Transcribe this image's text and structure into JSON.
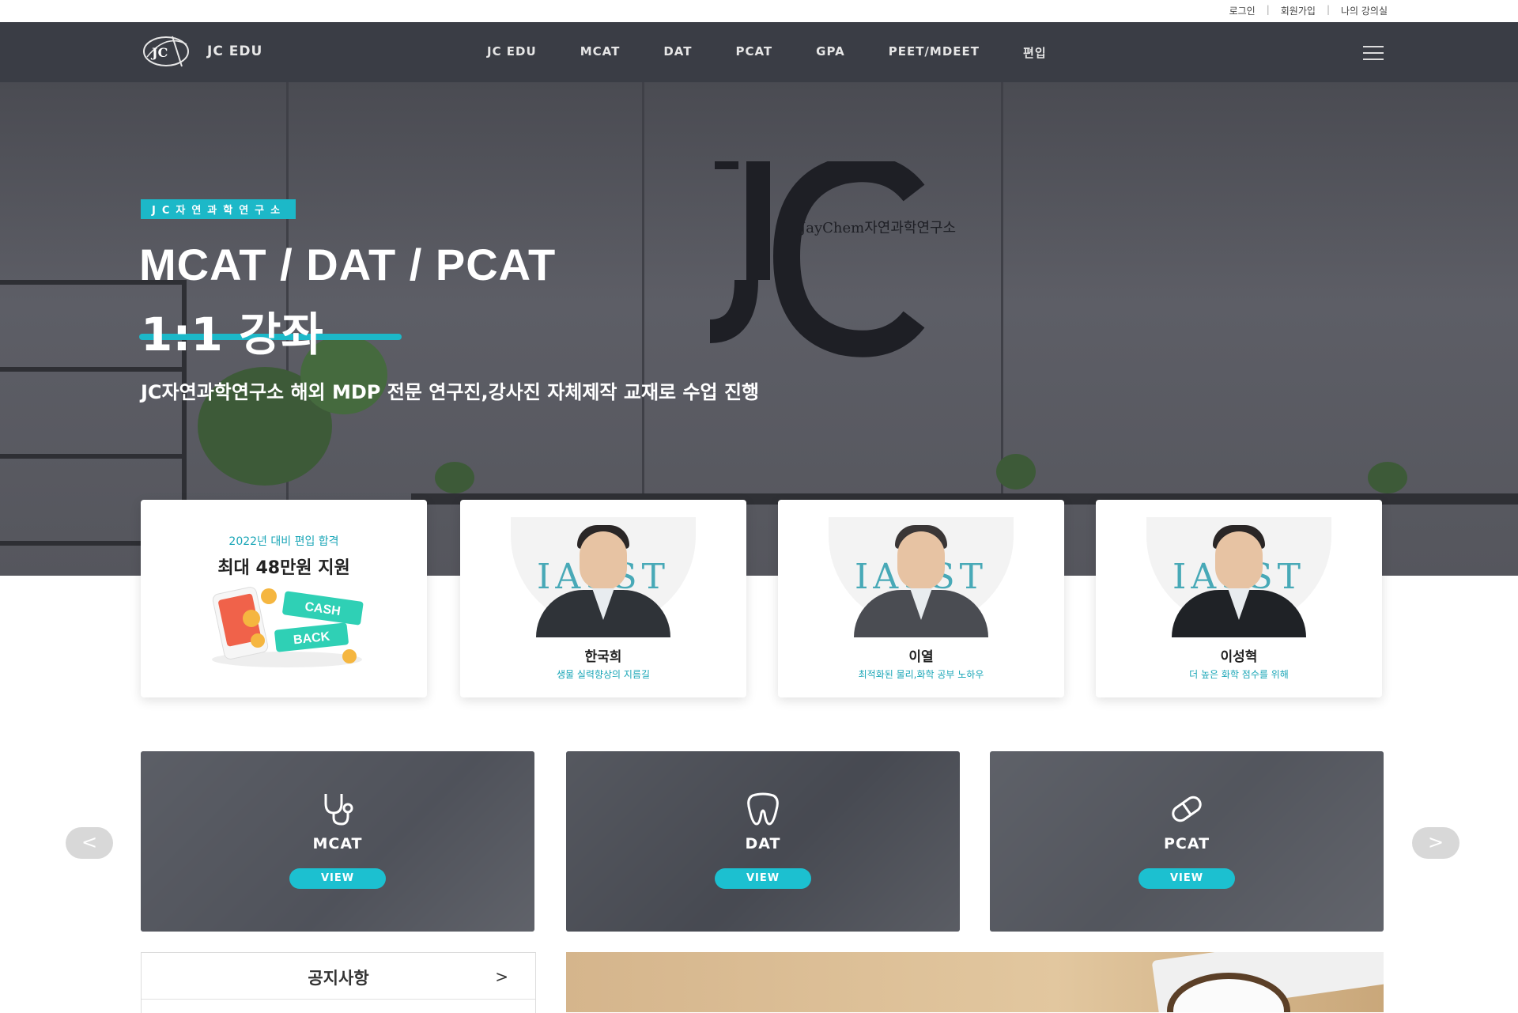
{
  "utility_links": [
    "로그인",
    "회원가입",
    "나의 강의실"
  ],
  "utility_separator": "|",
  "brand": {
    "name": "JC EDU",
    "mark": "JC"
  },
  "nav": {
    "items": [
      "JC EDU",
      "MCAT",
      "DAT",
      "PCAT",
      "GPA",
      "PEET/MDEET",
      "편입"
    ]
  },
  "hero": {
    "badge": "JC자연과학연구소",
    "title": "MCAT / DAT / PCAT",
    "subtitle": "1:1 강좌",
    "description": "JC자연과학연구소 해외 MDP 전문 연구진,강사진 자체제작 교재로 수업 진행",
    "wall_sign": "JayChem자연과학연구소"
  },
  "promo": {
    "sub": "2022년 대비 편입 합격",
    "main": "최대 48만원 지원",
    "ticket1": "CASH",
    "ticket2": "BACK"
  },
  "instructors": [
    {
      "name": "한국희",
      "desc": "생물 실력향상의 지름길",
      "bg": "IASST"
    },
    {
      "name": "이열",
      "desc": "최적화된 물리,화학 공부 노하우",
      "bg": "IASST"
    },
    {
      "name": "이성혁",
      "desc": "더 높은 화학 점수를 위해",
      "bg": "IASST"
    }
  ],
  "courses": [
    {
      "title": "MCAT",
      "button": "VIEW",
      "icon": "stethoscope-icon"
    },
    {
      "title": "DAT",
      "button": "VIEW",
      "icon": "tooth-icon"
    },
    {
      "title": "PCAT",
      "button": "VIEW",
      "icon": "pill-icon"
    }
  ],
  "carousel": {
    "prev": "<",
    "next": ">"
  },
  "notice": {
    "label": "공지사항",
    "chevron": ">"
  },
  "colors": {
    "accent": "#1cb8c8",
    "nav_bg": "#3a3d45",
    "hero_bg": "#55565d"
  }
}
